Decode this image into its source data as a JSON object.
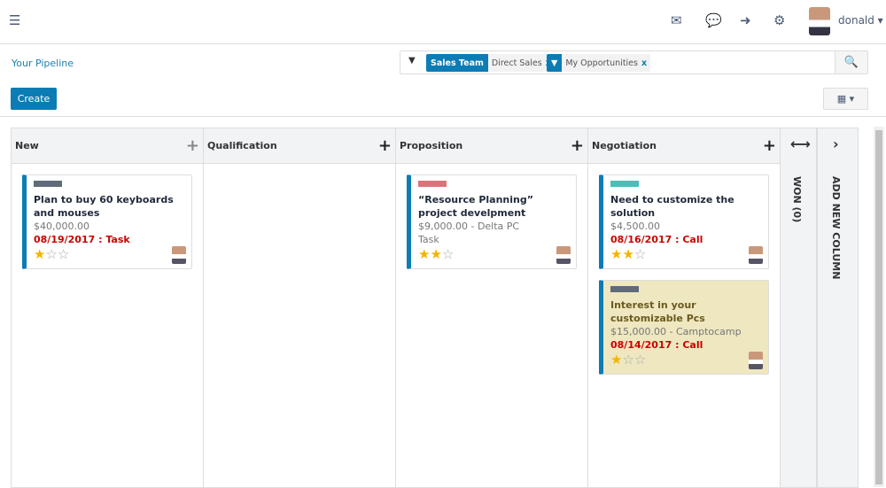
{
  "topbar": {
    "menu_icon": "menu-toggle-icon",
    "icons": [
      "envelope-icon",
      "chat-icon",
      "sign-out-icon",
      "gear-icon"
    ],
    "user": "donald ▾"
  },
  "breadcrumb": "Your Pipeline",
  "search": {
    "facets": [
      {
        "label": "Sales Team",
        "value": "Direct Sales"
      },
      {
        "label": "filter-icon",
        "value": "My Opportunities"
      }
    ],
    "remove": "x"
  },
  "create_label": "Create",
  "view_label": "▦ ▾",
  "colors": {
    "primary": "#0c7cb5",
    "deadline": "#cc0000",
    "star": "#f2b400"
  },
  "columns": [
    {
      "name": "New",
      "cards": [
        {
          "title": "Plan to buy 60 keyboards and mouses",
          "amount": "$40,000.00",
          "date": "08/19/2017 : Task",
          "tag": "#5f6b7a",
          "stars": 1
        }
      ]
    },
    {
      "name": "Qualification",
      "cards": []
    },
    {
      "name": "Proposition",
      "cards": [
        {
          "title": "“Resource Planning” project develpment",
          "amount": "$9,000.00 - Delta PC",
          "extra": "Task",
          "tag": "#d9747a",
          "stars": 2
        }
      ]
    },
    {
      "name": "Negotiation",
      "cards": [
        {
          "title": "Need to customize the solution",
          "amount": "$4,500.00",
          "date": "08/16/2017 : Call",
          "tag": "#4dbdb6",
          "stars": 2
        },
        {
          "title": "Interest in your customizable Pcs",
          "amount": "$15,000.00 - Camptocamp",
          "date": "08/14/2017 : Call",
          "tag": "#5f6b7a",
          "stars": 1,
          "highlight": true
        }
      ]
    }
  ],
  "won": {
    "label": "WON (0)"
  },
  "add_column": "ADD NEW COLUMN"
}
